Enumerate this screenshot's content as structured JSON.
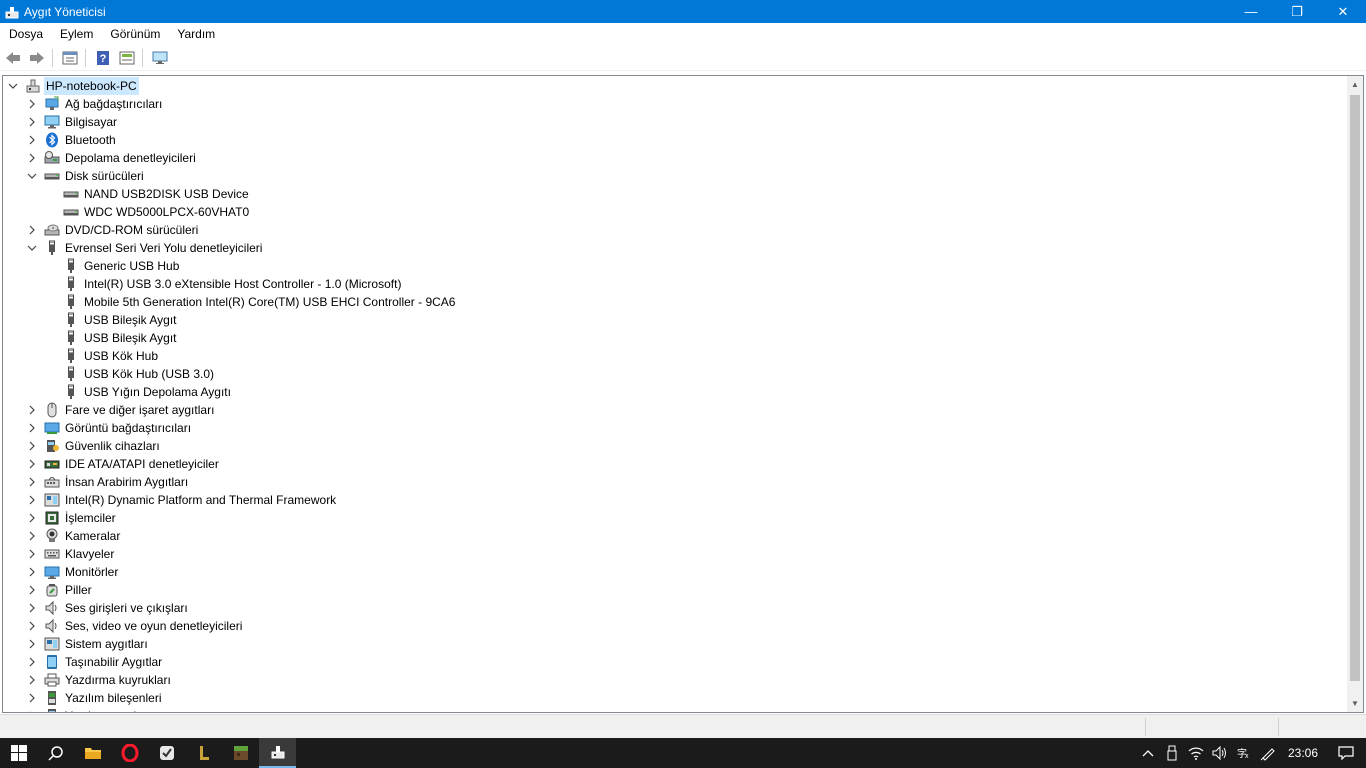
{
  "window": {
    "title": "Aygıt Yöneticisi",
    "minimize_glyph": "—",
    "maximize_glyph": "❐",
    "close_glyph": "✕"
  },
  "menu": [
    "Dosya",
    "Eylem",
    "Görünüm",
    "Yardım"
  ],
  "toolbar": {
    "buttons": [
      "back-arrow-icon",
      "forward-arrow-icon",
      "properties-icon",
      "help-icon",
      "update-driver-icon",
      "scan-hardware-icon"
    ]
  },
  "tree": {
    "root": "HP-notebook-PC",
    "nodes": [
      {
        "label": "Ağ bağdaştırıcıları",
        "level": 1,
        "expand": "collapsed",
        "icon": "network-adapter-icon"
      },
      {
        "label": "Bilgisayar",
        "level": 1,
        "expand": "collapsed",
        "icon": "computer-icon"
      },
      {
        "label": "Bluetooth",
        "level": 1,
        "expand": "collapsed",
        "icon": "bluetooth-icon"
      },
      {
        "label": "Depolama denetleyicileri",
        "level": 1,
        "expand": "collapsed",
        "icon": "storage-controller-icon"
      },
      {
        "label": "Disk sürücüleri",
        "level": 1,
        "expand": "expanded",
        "icon": "disk-drive-icon"
      },
      {
        "label": "NAND USB2DISK USB Device",
        "level": 2,
        "expand": "none",
        "icon": "disk-drive-icon"
      },
      {
        "label": "WDC WD5000LPCX-60VHAT0",
        "level": 2,
        "expand": "none",
        "icon": "disk-drive-icon"
      },
      {
        "label": "DVD/CD-ROM sürücüleri",
        "level": 1,
        "expand": "collapsed",
        "icon": "dvd-drive-icon"
      },
      {
        "label": "Evrensel Seri Veri Yolu denetleyicileri",
        "level": 1,
        "expand": "expanded",
        "icon": "usb-icon"
      },
      {
        "label": "Generic USB Hub",
        "level": 2,
        "expand": "none",
        "icon": "usb-icon"
      },
      {
        "label": "Intel(R) USB 3.0 eXtensible Host Controller - 1.0 (Microsoft)",
        "level": 2,
        "expand": "none",
        "icon": "usb-icon"
      },
      {
        "label": "Mobile 5th Generation Intel(R) Core(TM) USB EHCI Controller - 9CA6",
        "level": 2,
        "expand": "none",
        "icon": "usb-icon"
      },
      {
        "label": "USB Bileşik Aygıt",
        "level": 2,
        "expand": "none",
        "icon": "usb-icon"
      },
      {
        "label": "USB Bileşik Aygıt",
        "level": 2,
        "expand": "none",
        "icon": "usb-icon"
      },
      {
        "label": "USB Kök Hub",
        "level": 2,
        "expand": "none",
        "icon": "usb-icon"
      },
      {
        "label": "USB Kök Hub (USB 3.0)",
        "level": 2,
        "expand": "none",
        "icon": "usb-icon"
      },
      {
        "label": "USB Yığın Depolama Aygıtı",
        "level": 2,
        "expand": "none",
        "icon": "usb-icon"
      },
      {
        "label": "Fare ve diğer işaret aygıtları",
        "level": 1,
        "expand": "collapsed",
        "icon": "mouse-icon"
      },
      {
        "label": "Görüntü bağdaştırıcıları",
        "level": 1,
        "expand": "collapsed",
        "icon": "display-adapter-icon"
      },
      {
        "label": "Güvenlik cihazları",
        "level": 1,
        "expand": "collapsed",
        "icon": "security-device-icon"
      },
      {
        "label": "IDE ATA/ATAPI denetleyiciler",
        "level": 1,
        "expand": "collapsed",
        "icon": "ide-controller-icon"
      },
      {
        "label": "İnsan Arabirim Aygıtları",
        "level": 1,
        "expand": "collapsed",
        "icon": "hid-icon"
      },
      {
        "label": "Intel(R) Dynamic Platform and Thermal Framework",
        "level": 1,
        "expand": "collapsed",
        "icon": "thermal-framework-icon"
      },
      {
        "label": "İşlemciler",
        "level": 1,
        "expand": "collapsed",
        "icon": "processor-icon"
      },
      {
        "label": "Kameralar",
        "level": 1,
        "expand": "collapsed",
        "icon": "camera-icon"
      },
      {
        "label": "Klavyeler",
        "level": 1,
        "expand": "collapsed",
        "icon": "keyboard-icon"
      },
      {
        "label": "Monitörler",
        "level": 1,
        "expand": "collapsed",
        "icon": "monitor-icon"
      },
      {
        "label": "Piller",
        "level": 1,
        "expand": "collapsed",
        "icon": "battery-icon"
      },
      {
        "label": "Ses girişleri ve çıkışları",
        "level": 1,
        "expand": "collapsed",
        "icon": "audio-io-icon"
      },
      {
        "label": "Ses, video ve oyun denetleyicileri",
        "level": 1,
        "expand": "collapsed",
        "icon": "sound-controller-icon"
      },
      {
        "label": "Sistem aygıtları",
        "level": 1,
        "expand": "collapsed",
        "icon": "system-device-icon"
      },
      {
        "label": "Taşınabilir Aygıtlar",
        "level": 1,
        "expand": "collapsed",
        "icon": "portable-device-icon"
      },
      {
        "label": "Yazdırma kuyrukları",
        "level": 1,
        "expand": "collapsed",
        "icon": "print-queue-icon"
      },
      {
        "label": "Yazılım bileşenleri",
        "level": 1,
        "expand": "collapsed",
        "icon": "software-component-icon"
      },
      {
        "label": "Yazılım aygıtları",
        "level": 1,
        "expand": "collapsed",
        "icon": "software-device-icon"
      }
    ]
  },
  "taskbar": {
    "apps": [
      "windows-start-icon",
      "search-icon",
      "file-explorer-icon",
      "opera-icon",
      "app-check-icon",
      "app-l-icon",
      "minecraft-icon",
      "device-manager-icon"
    ],
    "tray": [
      "chevron-up-icon",
      "usb-device-icon",
      "wifi-icon",
      "volume-icon",
      "input-language-icon",
      "pen-icon"
    ],
    "clock": "23:06"
  },
  "colors": {
    "titlebar": "#0078d7",
    "selection": "#cce8ff",
    "taskbar": "#1b1b1b"
  }
}
